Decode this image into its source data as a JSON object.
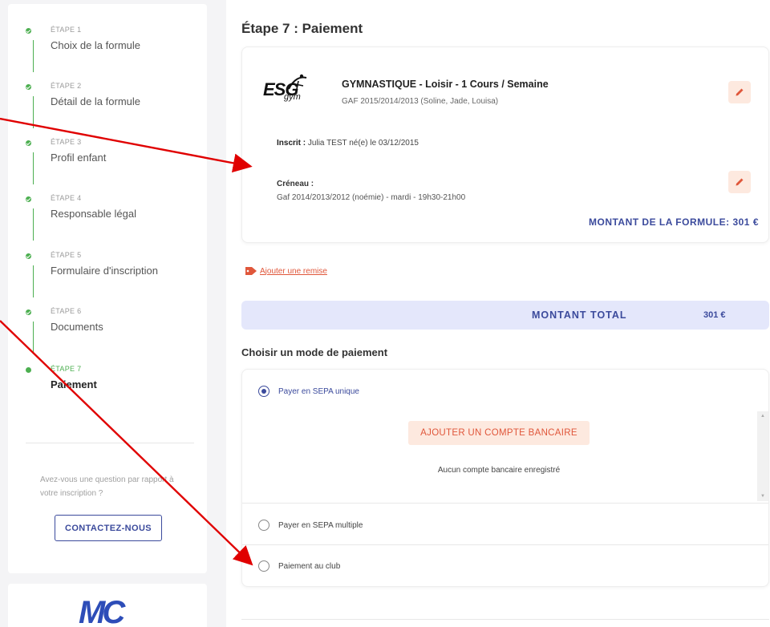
{
  "sidebar": {
    "steps": [
      {
        "num": "ÉTAPE 1",
        "title": "Choix de la formule"
      },
      {
        "num": "ÉTAPE 2",
        "title": "Détail de la formule"
      },
      {
        "num": "ÉTAPE 3",
        "title": "Profil enfant"
      },
      {
        "num": "ÉTAPE 4",
        "title": "Responsable légal"
      },
      {
        "num": "ÉTAPE 5",
        "title": "Formulaire d'inscription"
      },
      {
        "num": "ÉTAPE 6",
        "title": "Documents"
      },
      {
        "num": "ÉTAPE 7",
        "title": "Paiement"
      }
    ],
    "help_text": "Avez-vous une question par rapport à votre inscription ?",
    "contact_label": "CONTACTEZ-NOUS",
    "logo_text": "MC"
  },
  "main": {
    "title": "Étape 7 : Paiement",
    "formula": {
      "logo_text": "ESG",
      "logo_sub": "gym",
      "title": "GYMNASTIQUE - Loisir - 1 Cours / Semaine",
      "subtitle": "GAF 2015/2014/2013 (Soline, Jade, Louisa)",
      "inscrit_label": "Inscrit :",
      "inscrit_value": "Julia TEST né(e) le 03/12/2015",
      "creneau_label": "Créneau :",
      "creneau_value": "Gaf 2014/2013/2012 (noémie) - mardi - 19h30-21h00",
      "montant": "MONTANT DE LA FORMULE: 301 €"
    },
    "remise_link": "Ajouter une remise",
    "total_label": "MONTANT TOTAL",
    "total_value": "301 €",
    "payment_title": "Choisir un mode de paiement",
    "options": [
      {
        "label": "Payer en SEPA unique",
        "selected": true
      },
      {
        "label": "Payer en SEPA multiple",
        "selected": false
      },
      {
        "label": "Paiement au club",
        "selected": false
      }
    ],
    "add_bank_label": "AJOUTER UN COMPTE BANCAIRE",
    "no_bank_text": "Aucun compte bancaire enregistré"
  },
  "colors": {
    "accent": "#3b4a9c",
    "success": "#4caf50",
    "warning": "#e0573b",
    "arrow": "#e00000"
  }
}
